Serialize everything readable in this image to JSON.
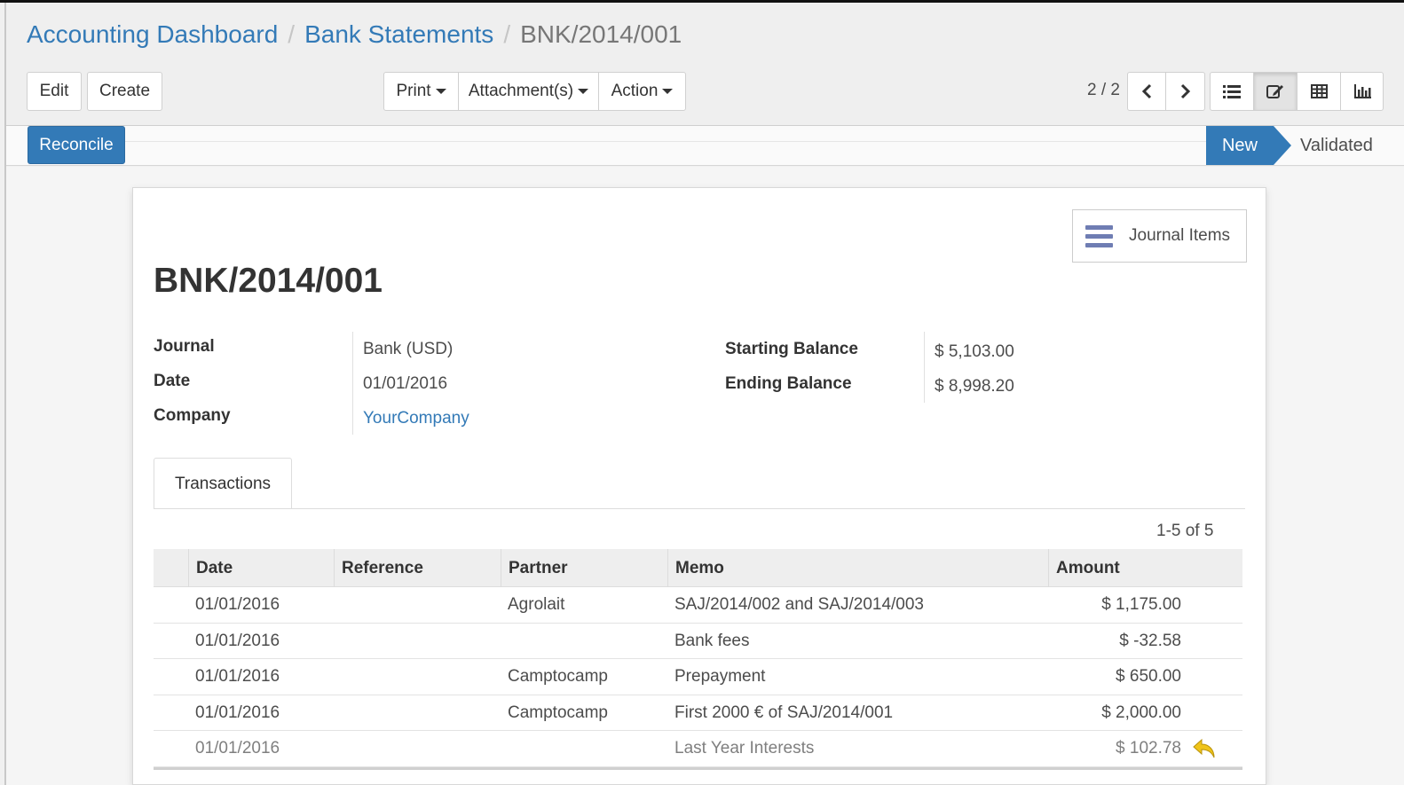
{
  "breadcrumb": {
    "items": [
      "Accounting Dashboard",
      "Bank Statements"
    ],
    "current": "BNK/2014/001",
    "separator": "/"
  },
  "toolbar": {
    "edit_label": "Edit",
    "create_label": "Create",
    "print_label": "Print",
    "attachments_label": "Attachment(s)",
    "action_label": "Action"
  },
  "pager": {
    "value": "2 / 2"
  },
  "views": {
    "list_icon": "list-icon",
    "form_icon": "edit-icon",
    "pivot_icon": "table-icon",
    "graph_icon": "bar-chart-icon",
    "active": "form"
  },
  "statusbar": {
    "reconcile_label": "Reconcile",
    "states": [
      "New",
      "Validated"
    ],
    "current_state": "New"
  },
  "form": {
    "journal_items_label": "Journal Items",
    "title": "BNK/2014/001",
    "left_fields": [
      {
        "label": "Journal",
        "value": "Bank (USD)"
      },
      {
        "label": "Date",
        "value": "01/01/2016"
      },
      {
        "label": "Company",
        "value": "YourCompany"
      }
    ],
    "right_fields": [
      {
        "label": "Starting Balance",
        "value": "$ 5,103.00"
      },
      {
        "label": "Ending Balance",
        "value": "$ 8,998.20"
      }
    ],
    "tab_label": "Transactions",
    "list_pager": "1-5 of 5",
    "columns": [
      "Date",
      "Reference",
      "Partner",
      "Memo",
      "Amount"
    ],
    "rows": [
      {
        "date": "01/01/2016",
        "reference": "",
        "partner": "Agrolait",
        "memo": "SAJ/2014/002 and SAJ/2014/003",
        "amount": "$ 1,175.00"
      },
      {
        "date": "01/01/2016",
        "reference": "",
        "partner": "",
        "memo": "Bank fees",
        "amount": "$ -32.58"
      },
      {
        "date": "01/01/2016",
        "reference": "",
        "partner": "Camptocamp",
        "memo": "Prepayment",
        "amount": "$ 650.00"
      },
      {
        "date": "01/01/2016",
        "reference": "",
        "partner": "Camptocamp",
        "memo": "First 2000 € of SAJ/2014/001",
        "amount": "$ 2,000.00"
      },
      {
        "date": "01/01/2016",
        "reference": "",
        "partner": "",
        "memo": "Last Year Interests",
        "amount": "$ 102.78"
      }
    ]
  },
  "colors": {
    "accent": "#337ab7",
    "reply_icon": "#f0c419"
  }
}
